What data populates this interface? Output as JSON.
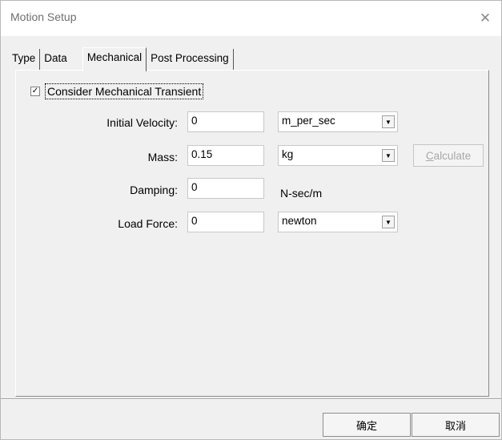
{
  "window": {
    "title": "Motion Setup",
    "close_glyph": "✕"
  },
  "tabs": [
    {
      "label": "Type"
    },
    {
      "label": "Data"
    },
    {
      "label": "Mechanical"
    },
    {
      "label": "Post Processing"
    }
  ],
  "active_tab": "Mechanical",
  "mechanical": {
    "consider_transient": {
      "label": "Consider Mechanical Transient",
      "checked": true,
      "check_glyph": "✓"
    },
    "initial_velocity": {
      "label": "Initial Velocity:",
      "value": "0",
      "unit": "m_per_sec"
    },
    "mass": {
      "label": "Mass:",
      "value": "0.15",
      "unit": "kg",
      "calculate_label_prefix": "C",
      "calculate_label_rest": "alculate"
    },
    "damping": {
      "label": "Damping:",
      "value": "0",
      "unit": "N-sec/m"
    },
    "load_force": {
      "label": "Load Force:",
      "value": "0",
      "unit": "newton"
    }
  },
  "footer": {
    "ok_label": "确定",
    "cancel_label": "取消"
  },
  "icons": {
    "dropdown_arrow": "▼"
  }
}
